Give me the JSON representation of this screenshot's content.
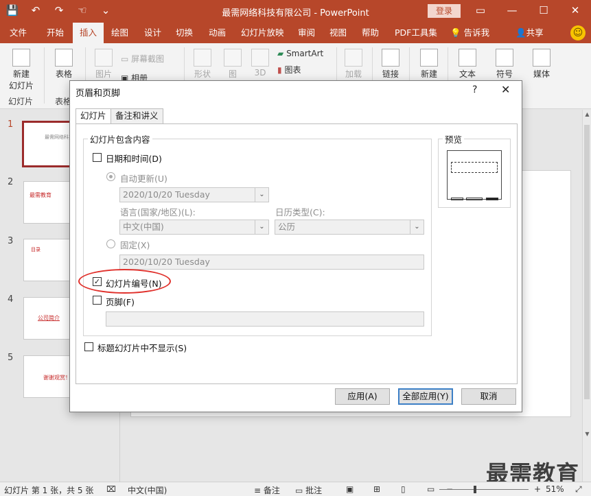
{
  "window": {
    "title": "最需网络科技有限公司 - PowerPoint",
    "login": "登录",
    "controls": [
      "▭",
      "—",
      "☐",
      "✕"
    ]
  },
  "qat": {
    "save_icon": "💾",
    "undo_icon": "↶",
    "redo_icon": "↷",
    "touch_icon": "☜",
    "more_icon": "⌄"
  },
  "tabs": [
    "文件",
    "开始",
    "插入",
    "绘图",
    "设计",
    "切换",
    "动画",
    "幻灯片放映",
    "审阅",
    "视图",
    "帮助",
    "PDF工具集"
  ],
  "tellme": "告诉我",
  "share": "共享",
  "smiley": "☺",
  "ribbon": {
    "new_slide": "新建",
    "new_slide2": "幻灯片",
    "table": "表格",
    "group_slides": "幻灯片",
    "group_tables": "表格",
    "pictures": "图片",
    "screenshot": "屏幕截图",
    "album": "相册",
    "shapes": "形状",
    "icons": "图",
    "3d": "3D",
    "smartart": "SmartArt",
    "chart": "图表",
    "addin": "加载",
    "link": "链接",
    "new_comment": "新建",
    "text": "文本",
    "symbol": "符号",
    "media": "媒体"
  },
  "slides": [
    {
      "num": "1",
      "text": "最需网络科技有限公司"
    },
    {
      "num": "2",
      "text": "最需教育"
    },
    {
      "num": "3",
      "text": "目录"
    },
    {
      "num": "4",
      "text": "公司简介"
    },
    {
      "num": "5",
      "text": "谢谢观赏！"
    }
  ],
  "dialog": {
    "title": "页眉和页脚",
    "help": "?",
    "close": "✕",
    "tab_slide": "幻灯片",
    "tab_notes": "备注和讲义",
    "group_include": "幻灯片包含内容",
    "date_time": "日期和时间(D)",
    "auto_update": "自动更新(U)",
    "auto_date": "2020/10/20 Tuesday",
    "language_label": "语言(国家/地区)(L):",
    "language_value": "中文(中国)",
    "calendar_label": "日历类型(C):",
    "calendar_value": "公历",
    "fixed": "固定(X)",
    "fixed_value": "2020/10/20 Tuesday",
    "slide_number": "幻灯片编号(N)",
    "footer": "页脚(F)",
    "footer_value": "",
    "no_title_slide": "标题幻灯片中不显示(S)",
    "preview": "预览",
    "apply": "应用(A)",
    "apply_all": "全部应用(Y)",
    "cancel": "取消",
    "checked_mark": "✓",
    "dropdown_arrow": "⌄"
  },
  "status": {
    "slide_info": "幻灯片 第 1 张，共 5 张",
    "language": "中文(中国)",
    "notes": "备注",
    "comments": "批注",
    "zoom": "51%",
    "minus": "−",
    "plus": "+"
  },
  "watermark": "最需教育",
  "colors": {
    "accent": "#b7472a",
    "highlight": "#e0302b"
  }
}
